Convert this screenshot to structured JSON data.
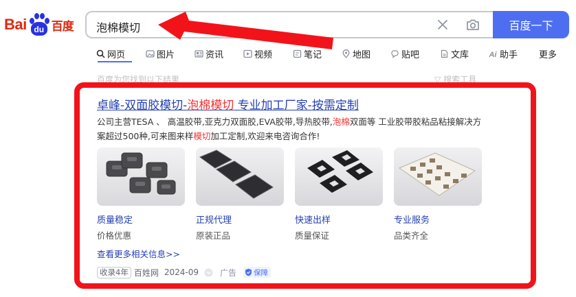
{
  "logo": {
    "text_bai": "Bai",
    "text_du": "du",
    "text_cn": "百度"
  },
  "search": {
    "query": "泡棉模切",
    "button_label": "百度一下"
  },
  "tabs": [
    {
      "label": "网页",
      "icon": "search-icon"
    },
    {
      "label": "图片",
      "icon": "image-icon"
    },
    {
      "label": "资讯",
      "icon": "news-icon"
    },
    {
      "label": "视频",
      "icon": "video-icon"
    },
    {
      "label": "笔记",
      "icon": "note-icon"
    },
    {
      "label": "地图",
      "icon": "map-pin-icon"
    },
    {
      "label": "贴吧",
      "icon": "tieba-icon"
    },
    {
      "label": "文库",
      "icon": "doc-icon"
    },
    {
      "label": "助手",
      "icon": "ai-icon"
    },
    {
      "label": "更多",
      "icon": ""
    }
  ],
  "faded": {
    "left": "百度为您找到以下结果",
    "right": "搜索工具"
  },
  "ad": {
    "title_part1": "卓峰-双面胶模切-",
    "title_highlight": "泡棉模切",
    "title_part2": " 专业加工厂家-按需定制",
    "desc_1": "公司主营TESA 、 高温胶带,亚克力双面胶,EVA胶带,导热胶带,",
    "desc_hl1": "泡棉",
    "desc_2": "双面等 工业胶带胶粘品粘接解决方案超过500种,可来图来样",
    "desc_hl2": "模切",
    "desc_3": "加工定制,欢迎来电咨询合作!",
    "features": [
      {
        "title": "质量稳定",
        "subtitle": "价格优惠"
      },
      {
        "title": "正规代理",
        "subtitle": "原装正品"
      },
      {
        "title": "快速出样",
        "subtitle": "质量保证"
      },
      {
        "title": "专业服务",
        "subtitle": "品类齐全"
      }
    ],
    "more_link": "查看更多相关信息>>",
    "footer": {
      "badge": "收录4年",
      "source": "百姓网",
      "date": "2024-09",
      "ad_label": "广告",
      "protect_label": "保障"
    }
  },
  "colors": {
    "accent": "#4e6ef2",
    "link": "#2440b3",
    "highlight": "#f73131",
    "annotation_red": "#f2131a"
  }
}
